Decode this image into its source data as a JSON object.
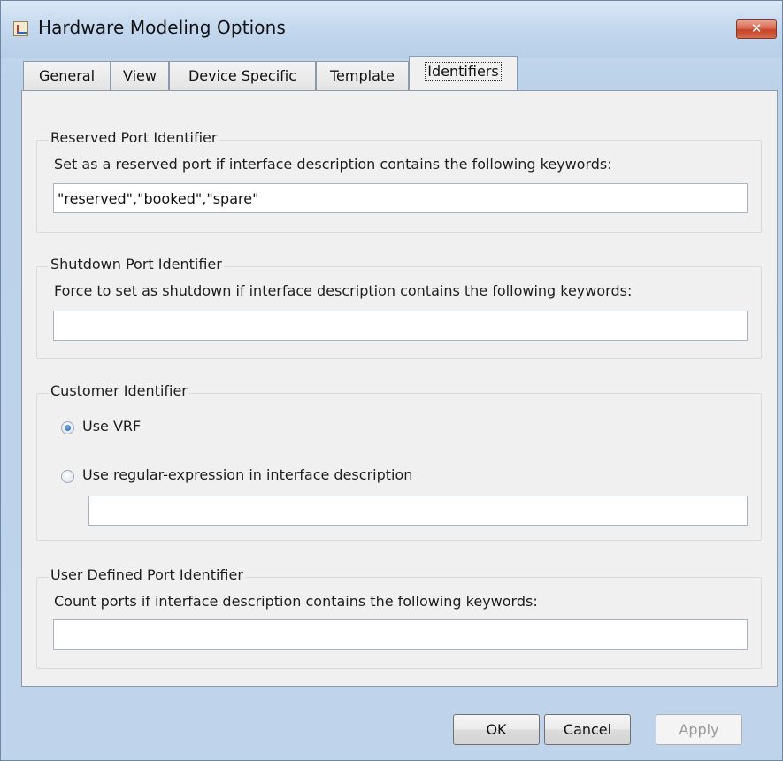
{
  "window": {
    "title": "Hardware Modeling Options",
    "close_label": "✕"
  },
  "tabs": [
    {
      "label": "General"
    },
    {
      "label": "View"
    },
    {
      "label": "Device Specific"
    },
    {
      "label": "Template"
    },
    {
      "label": "Identifiers",
      "active": true
    }
  ],
  "reserved": {
    "title": "Reserved Port Identifier",
    "description": "Set as a reserved port if interface description contains the following keywords:",
    "value": "\"reserved\",\"booked\",\"spare\""
  },
  "shutdown": {
    "title": "Shutdown Port Identifier",
    "description": "Force to set as shutdown if interface description contains the following keywords:",
    "value": ""
  },
  "customer": {
    "title": "Customer Identifier",
    "option_vrf": "Use VRF",
    "option_regex": "Use regular-expression in interface description",
    "selected": "vrf",
    "regex_value": ""
  },
  "user_defined": {
    "title": "User Defined Port Identifier",
    "description": "Count ports if interface description contains the following keywords:",
    "value": ""
  },
  "buttons": {
    "ok": "OK",
    "cancel": "Cancel",
    "apply": "Apply"
  }
}
